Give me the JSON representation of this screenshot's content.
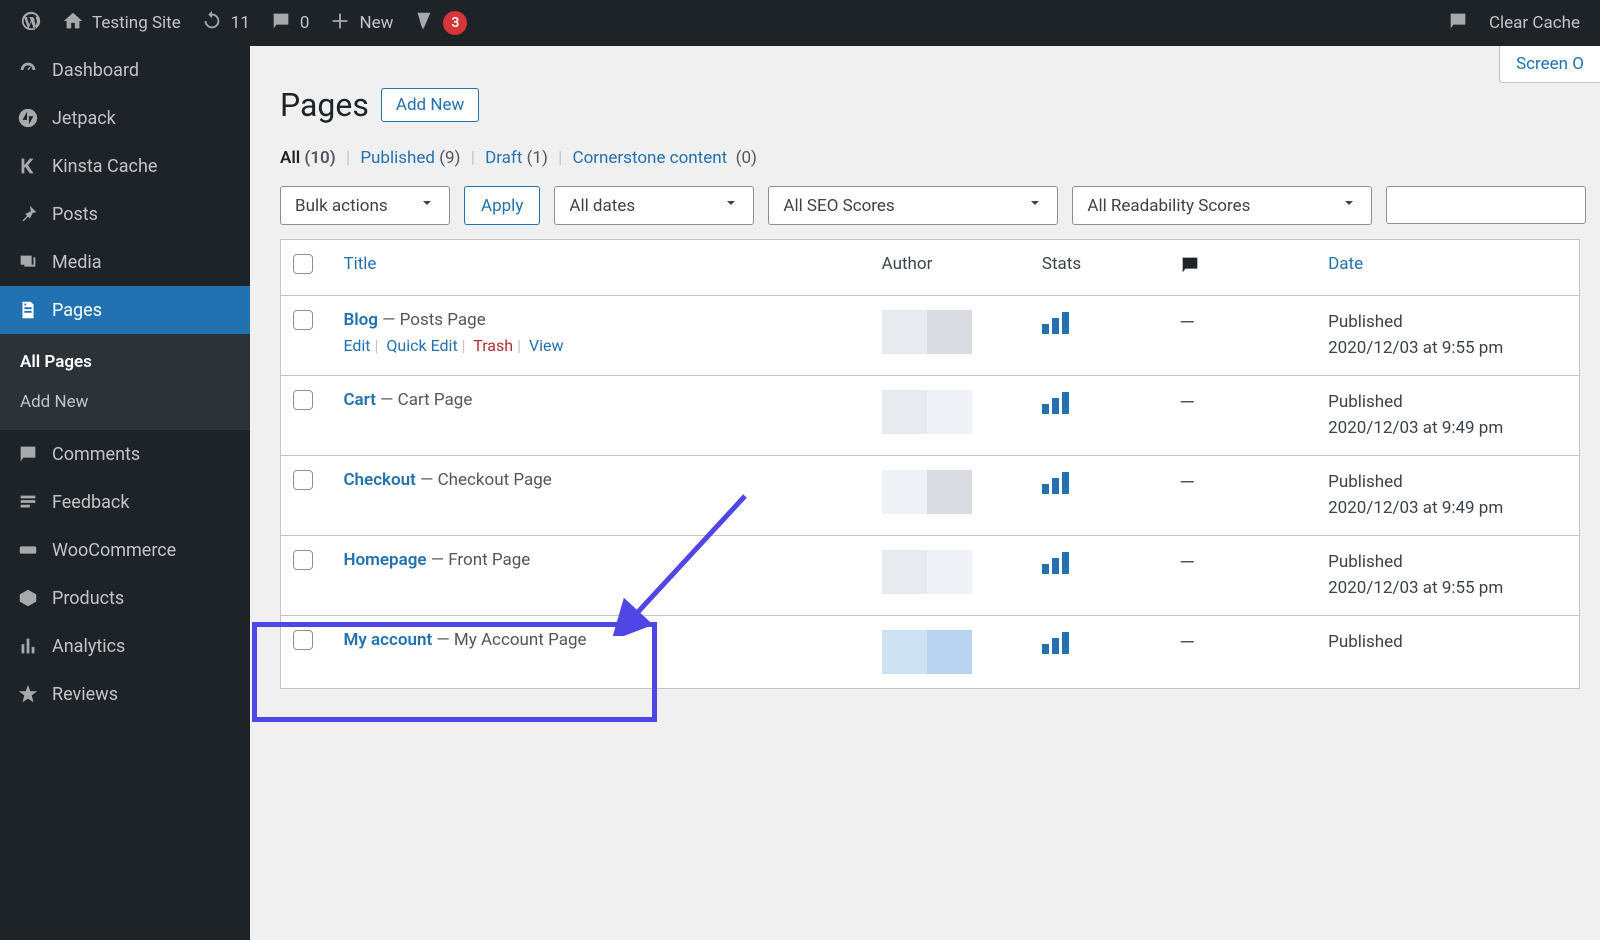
{
  "adminbar": {
    "site_name": "Testing Site",
    "updates_count": "11",
    "comments_count": "0",
    "new_label": "New",
    "yoast_count": "3",
    "clear_cache": "Clear Cache"
  },
  "sidebar": {
    "items": [
      {
        "label": "Dashboard"
      },
      {
        "label": "Jetpack"
      },
      {
        "label": "Kinsta Cache"
      },
      {
        "label": "Posts"
      },
      {
        "label": "Media"
      },
      {
        "label": "Pages"
      },
      {
        "label": "Comments"
      },
      {
        "label": "Feedback"
      },
      {
        "label": "WooCommerce"
      },
      {
        "label": "Products"
      },
      {
        "label": "Analytics"
      },
      {
        "label": "Reviews"
      }
    ],
    "submenu": [
      {
        "label": "All Pages"
      },
      {
        "label": "Add New"
      }
    ]
  },
  "heading": {
    "title": "Pages",
    "add_new_btn": "Add New",
    "screen_options": "Screen O"
  },
  "filters": {
    "all": {
      "label": "All",
      "count": "(10)"
    },
    "published": {
      "label": "Published",
      "count": "(9)"
    },
    "draft": {
      "label": "Draft",
      "count": "(1)"
    },
    "cornerstone": {
      "label": "Cornerstone content",
      "count": "(0)"
    }
  },
  "controls": {
    "bulk_actions": "Bulk actions",
    "apply": "Apply",
    "all_dates": "All dates",
    "all_seo": "All SEO Scores",
    "all_readability": "All Readability Scores"
  },
  "columns": {
    "title": "Title",
    "author": "Author",
    "stats": "Stats",
    "date": "Date"
  },
  "row_actions": {
    "edit": "Edit",
    "quick_edit": "Quick Edit",
    "trash": "Trash",
    "view": "View"
  },
  "rows": [
    {
      "title": "Blog",
      "suffix": " — Posts Page",
      "date_label": "Published",
      "date_line": "2020/12/03 at 9:55 pm",
      "show_actions": true
    },
    {
      "title": "Cart",
      "suffix": " — Cart Page",
      "date_label": "Published",
      "date_line": "2020/12/03 at 9:49 pm"
    },
    {
      "title": "Checkout",
      "suffix": " — Checkout Page",
      "date_label": "Published",
      "date_line": "2020/12/03 at 9:49 pm"
    },
    {
      "title": "Homepage",
      "suffix": " — Front Page",
      "date_label": "Published",
      "date_line": "2020/12/03 at 9:55 pm"
    },
    {
      "title": "My account",
      "suffix": " — My Account Page",
      "date_label": "Published",
      "date_line": ""
    }
  ]
}
